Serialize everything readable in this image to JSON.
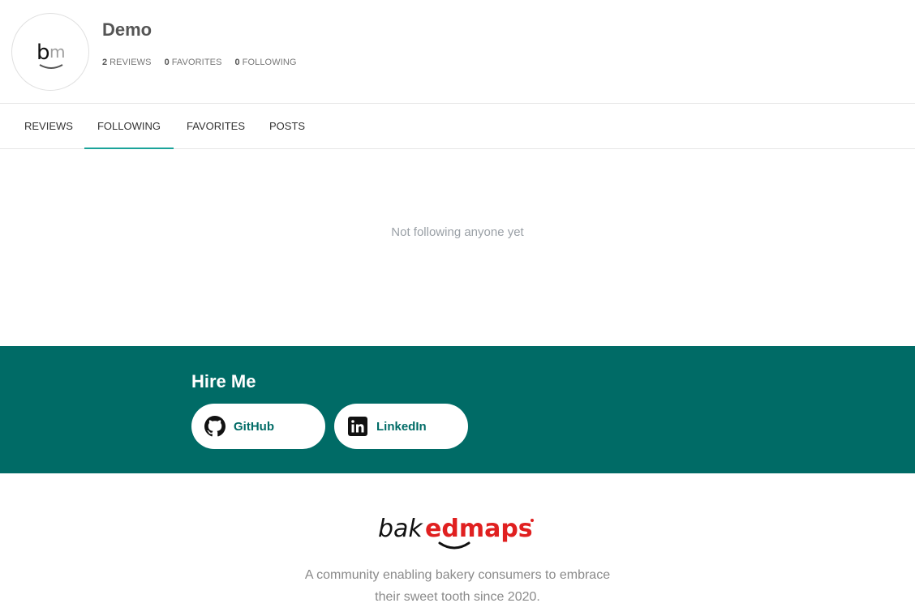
{
  "profile": {
    "avatar_monogram": "bm",
    "username": "Demo",
    "stats": [
      {
        "count": "2",
        "label": "REVIEWS"
      },
      {
        "count": "0",
        "label": "FAVORITES"
      },
      {
        "count": "0",
        "label": "FOLLOWING"
      }
    ]
  },
  "tabs": [
    {
      "label": "REVIEWS",
      "active": false
    },
    {
      "label": "FOLLOWING",
      "active": true
    },
    {
      "label": "FAVORITES",
      "active": false
    },
    {
      "label": "POSTS",
      "active": false
    }
  ],
  "content": {
    "empty_message": "Not following anyone yet"
  },
  "hire": {
    "title": "Hire Me",
    "buttons": [
      {
        "label": "GitHub",
        "icon": "github-icon"
      },
      {
        "label": "LinkedIn",
        "icon": "linkedin-icon"
      }
    ]
  },
  "footer": {
    "logo_text": "bakedmaps",
    "logo_part1": "bak",
    "logo_part2": "edmaps",
    "tagline_line1": "A community enabling bakery consumers to embrace",
    "tagline_line2": "their sweet tooth since 2020."
  },
  "colors": {
    "brand_teal": "#006b66",
    "tab_active": "#1aa39a",
    "logo_red": "#e02020"
  }
}
